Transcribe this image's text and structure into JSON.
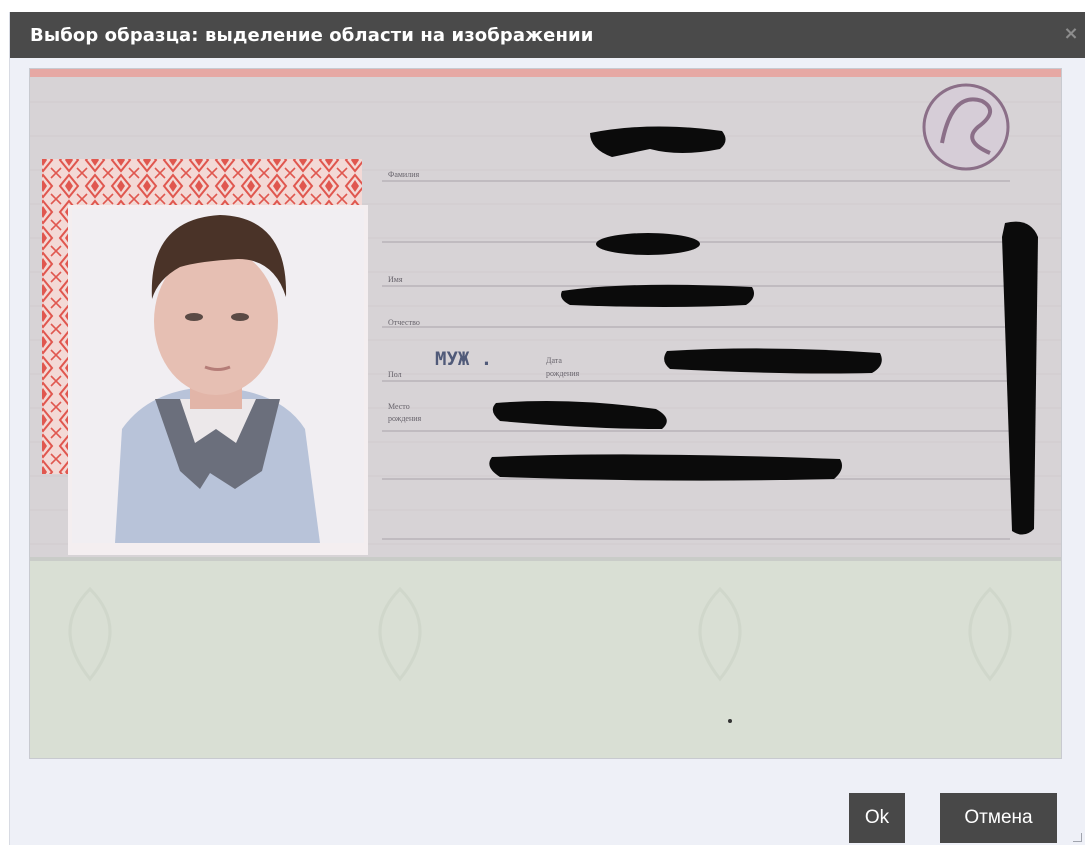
{
  "dialog": {
    "title": "Выбор образца: выделение области на изображении",
    "close_symbol": "×",
    "ok_label": "Ok",
    "cancel_label": "Отмена"
  },
  "document_image": {
    "icon": "passport-scan-image",
    "stamp_text": "МУЖ .",
    "field_labels": {
      "surname": "Фамилия",
      "name": "Имя",
      "patronymic": "Отчество",
      "sex": "Пол",
      "birth_date_line1": "Дата",
      "birth_date_line2": "рождения",
      "birth_place_line1": "Место",
      "birth_place_line2": "рождения"
    },
    "colors": {
      "paper": "#d7d3d6",
      "lower_page": "#d9dfd4",
      "ornament": "#e0574f",
      "redaction": "#0b0b0b",
      "seal": "#8b6f88"
    }
  }
}
